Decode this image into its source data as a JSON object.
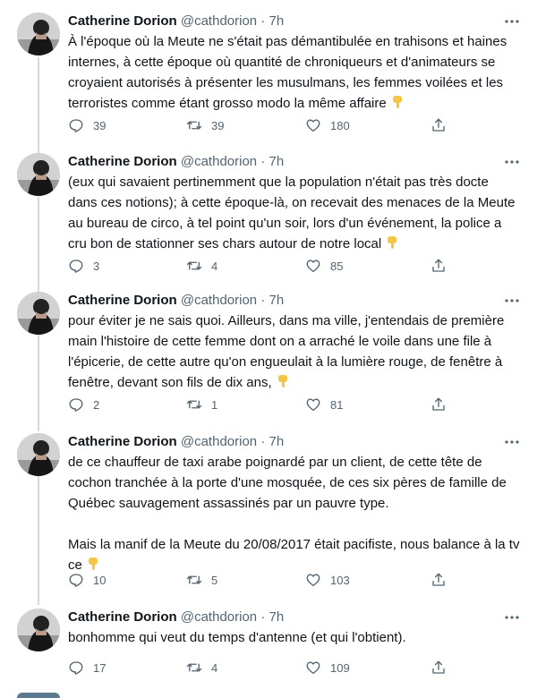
{
  "tweets": [
    {
      "name": "Catherine Dorion",
      "handle": "@cathdorion",
      "sep": "·",
      "time": "7h",
      "paragraphs": [
        "À l'époque où la Meute ne s'était pas démantibulée en trahisons et haines internes, à cette époque où quantité de chroniqueurs et d'animateurs se croyaient autorisés à présenter les musulmans, les femmes voilées et les terroristes comme étant grosso modo la même affaire"
      ],
      "emoji": "backhand-index-pointing-down",
      "replies": "39",
      "retweets": "39",
      "likes": "180"
    },
    {
      "name": "Catherine Dorion",
      "handle": "@cathdorion",
      "sep": "·",
      "time": "7h",
      "paragraphs": [
        "(eux qui savaient pertinemment que la population n'était pas très docte dans ces notions); à cette époque-là, on recevait des menaces de la Meute au bureau de circo, à tel point qu'un soir, lors d'un événement, la police a cru bon de stationner ses chars autour de notre local"
      ],
      "emoji": "backhand-index-pointing-down",
      "replies": "3",
      "retweets": "4",
      "likes": "85"
    },
    {
      "name": "Catherine Dorion",
      "handle": "@cathdorion",
      "sep": "·",
      "time": "7h",
      "paragraphs": [
        "pour éviter je ne sais quoi. Ailleurs, dans ma ville, j'entendais de première main l'histoire de cette femme dont on a arraché le voile dans une file à l'épicerie, de cette autre qu'on engueulait à la lumière rouge, de fenêtre à fenêtre, devant son fils de dix ans,"
      ],
      "emoji": "backhand-index-pointing-down",
      "replies": "2",
      "retweets": "1",
      "likes": "81"
    },
    {
      "name": "Catherine Dorion",
      "handle": "@cathdorion",
      "sep": "·",
      "time": "7h",
      "paragraphs": [
        "de ce chauffeur de taxi arabe poignardé par un client, de cette tête de cochon tranchée à la porte d'une mosquée, de ces six pères de famille de Québec sauvagement assassinés par un pauvre type.",
        "Mais la manif de la Meute du 20/08/2017 était pacifiste, nous balance à la tv ce"
      ],
      "emoji": "backhand-index-pointing-down",
      "replies": "10",
      "retweets": "5",
      "likes": "103"
    },
    {
      "name": "Catherine Dorion",
      "handle": "@cathdorion",
      "sep": "·",
      "time": "7h",
      "paragraphs": [
        "bonhomme qui veut du temps d'antenne (et qui l'obtient)."
      ],
      "emoji": "",
      "replies": "17",
      "retweets": "4",
      "likes": "109"
    }
  ],
  "colors": {
    "text": "#0f1419",
    "muted": "#536471",
    "thread_line": "#cfd9de",
    "emoji": "#f7c545"
  },
  "icons": {
    "reply": "reply-icon",
    "retweet": "retweet-icon",
    "like": "like-icon",
    "share": "share-icon",
    "more": "more-icon"
  }
}
